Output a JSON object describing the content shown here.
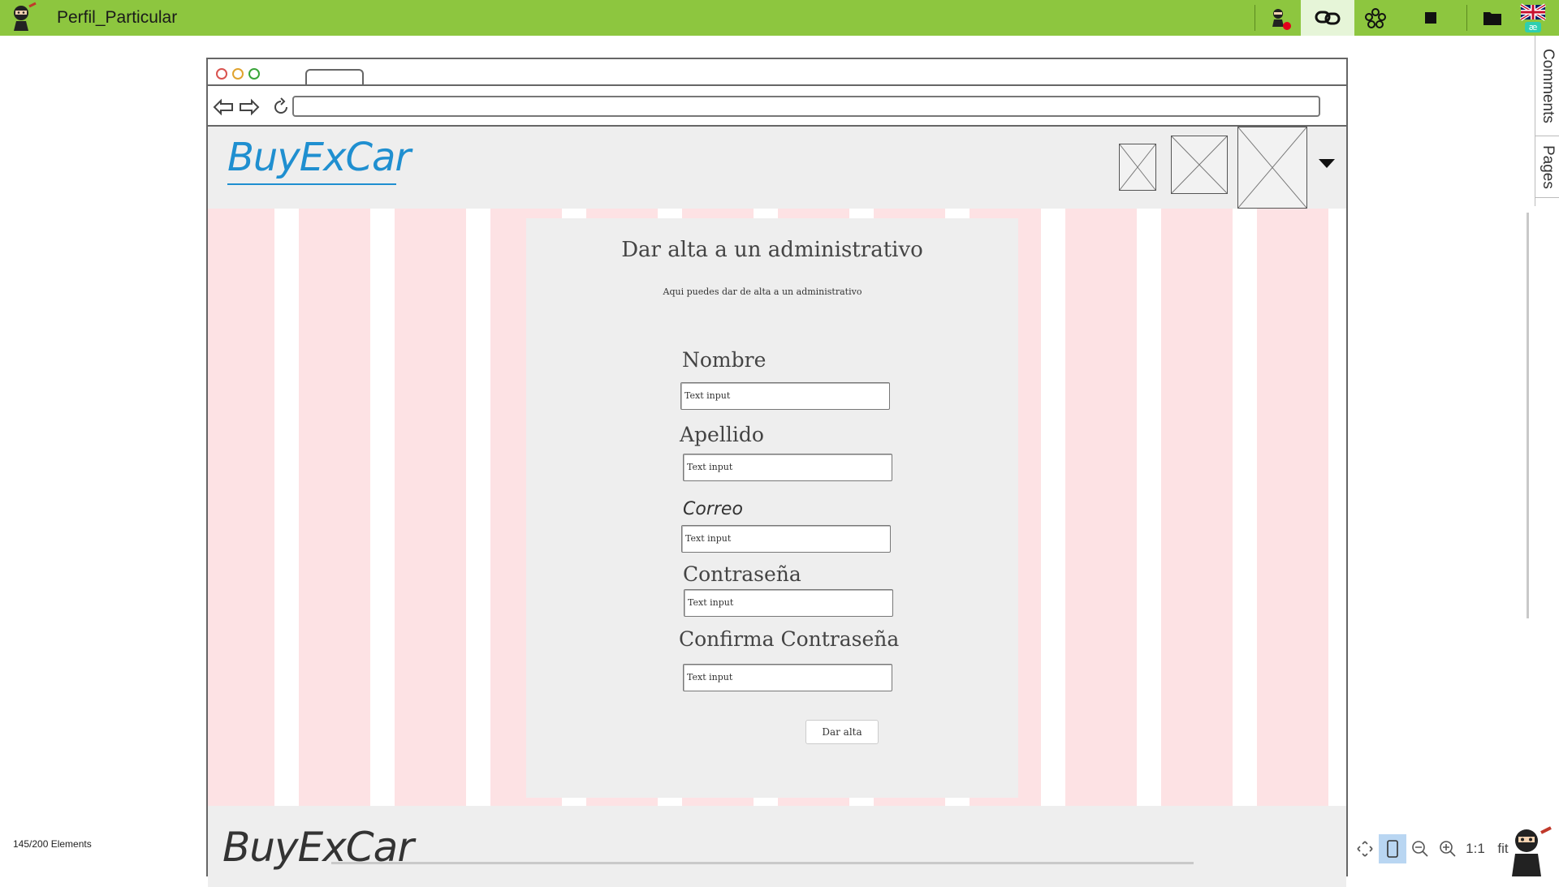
{
  "app": {
    "title": "Perfil_Particular",
    "status": "145/200 Elements"
  },
  "side_tabs": {
    "comments": "Comments",
    "pages": "Pages"
  },
  "bottom_toolbar": {
    "fit_actual": "1:1",
    "fit": "fit"
  },
  "site": {
    "brand": "BuyExCar",
    "footer_brand": "BuyExCar"
  },
  "form": {
    "title": "Dar alta a un administrativo",
    "subtitle": "Aqui puedes dar de alta a un administrativo",
    "fields": [
      {
        "label": "Nombre",
        "placeholder": "Text input"
      },
      {
        "label": "Apellido",
        "placeholder": "Text input"
      },
      {
        "label": "Correo",
        "placeholder": "Text input"
      },
      {
        "label": "Contraseña",
        "placeholder": "Text input"
      },
      {
        "label": "Confirma Contraseña",
        "placeholder": "Text input"
      }
    ],
    "submit": "Dar alta"
  },
  "colors": {
    "appbar": "#8dc63f",
    "grid_column": "#fde2e4",
    "brand_blue": "#1f8fd0",
    "panel": "#eeeeee"
  },
  "icons": {
    "toolbar": [
      "ninja-notification-icon",
      "link-icon",
      "collaborators-icon",
      "stop-icon",
      "folder-icon",
      "uk-flag-icon"
    ],
    "browser_nav": [
      "back-arrow-icon",
      "forward-arrow-icon",
      "reload-icon"
    ]
  }
}
